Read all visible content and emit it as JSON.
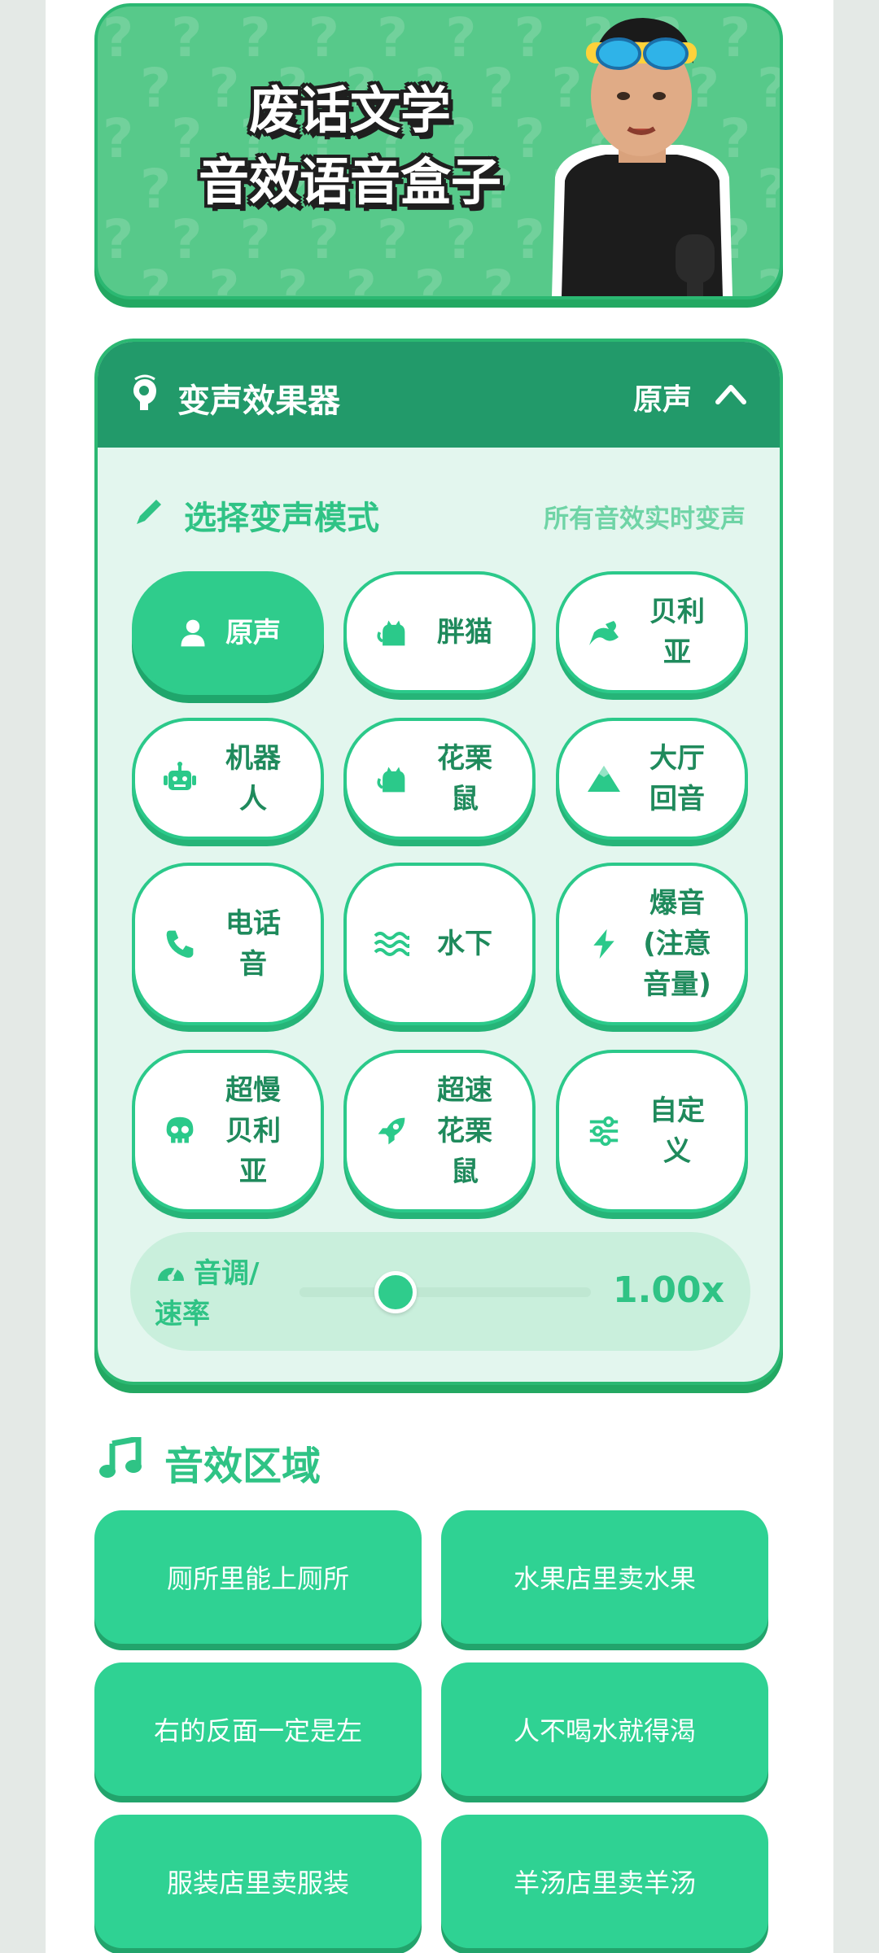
{
  "banner": {
    "title_line1": "废话文学",
    "title_line2": "音效语音盒子",
    "pattern_glyph": "?"
  },
  "voice_changer": {
    "title": "变声效果器",
    "current_mode": "原声",
    "section_label": "选择变声模式",
    "section_hint": "所有音效实时变声",
    "modes": [
      {
        "label": "原声",
        "icon": "user-icon",
        "active": true
      },
      {
        "label": "胖猫",
        "icon": "cat-icon",
        "active": false
      },
      {
        "label": "贝利亚",
        "icon": "dragon-icon",
        "active": false
      },
      {
        "label": "机器人",
        "icon": "robot-icon",
        "active": false
      },
      {
        "label": "花栗鼠",
        "icon": "cat-icon",
        "active": false
      },
      {
        "label": "大厅回音",
        "icon": "mountain-icon",
        "active": false
      },
      {
        "label": "电话音",
        "icon": "phone-icon",
        "active": false
      },
      {
        "label": "水下",
        "icon": "water-icon",
        "active": false
      },
      {
        "label": "爆音(注意音量)",
        "icon": "bolt-icon",
        "active": false
      },
      {
        "label": "超慢贝利亚",
        "icon": "skull-icon",
        "active": false
      },
      {
        "label": "超速花栗鼠",
        "icon": "rocket-icon",
        "active": false
      },
      {
        "label": "自定义",
        "icon": "sliders-icon",
        "active": false
      }
    ],
    "pitch": {
      "label": "音调/速率",
      "value_text": "1.00x",
      "level": 0.33
    }
  },
  "sound_effects": {
    "title": "音效区域",
    "items": [
      "厕所里能上厕所",
      "水果店里卖水果",
      "右的反面一定是左",
      "人不喝水就得渴",
      "服装店里卖服装",
      "羊汤店里卖羊汤"
    ]
  },
  "colors": {
    "primary": "#2fcc8c",
    "header": "#229a6a",
    "card_bg": "#e3f6ee",
    "text_dark_green": "#1f8a5c"
  }
}
